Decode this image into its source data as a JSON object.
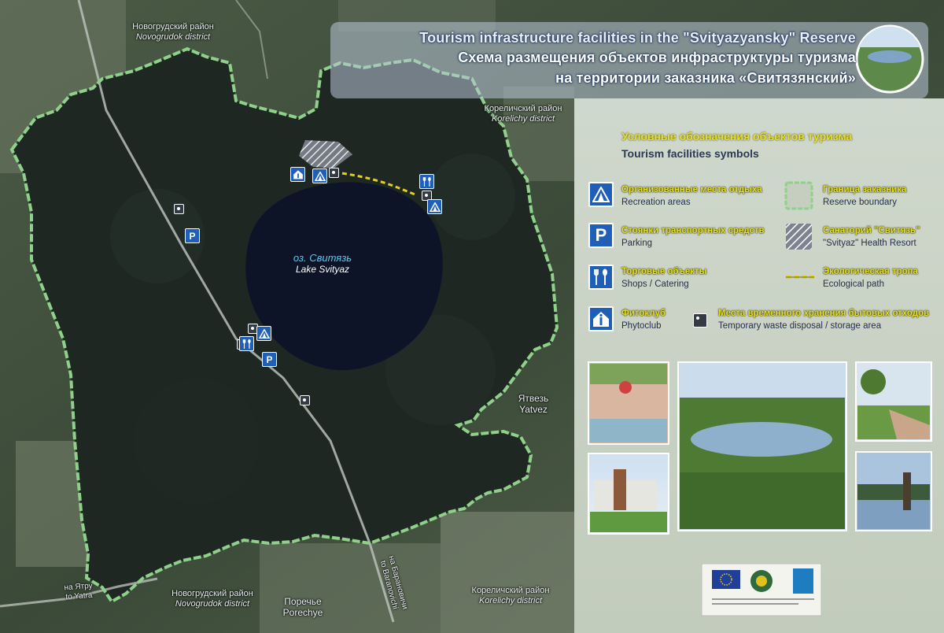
{
  "title": {
    "en": "Tourism infrastructure facilities in the \"Svityazyansky\" Reserve",
    "ru_line1": "Схема размещения объектов инфраструктуры туризма",
    "ru_line2": "на территории заказника «Свитязянский»"
  },
  "legend": {
    "title_ru": "Условные обозначения объектов туризма",
    "title_en": "Tourism facilities symbols",
    "items": [
      {
        "ru": "Организованные места отдыха",
        "en": "Recreation areas",
        "icon": "tent-icon"
      },
      {
        "ru": "Стоянки транспортных средств",
        "en": "Parking",
        "icon": "parking-icon"
      },
      {
        "ru": "Торговые объекты",
        "en": "Shops / Catering",
        "icon": "fork-spoon-icon"
      },
      {
        "ru": "Фитоклуб",
        "en": "Phytoclub",
        "icon": "info-house-icon"
      },
      {
        "ru": "Граница заказника",
        "en": "Reserve boundary",
        "icon": "boundary-icon"
      },
      {
        "ru": "Санаторий \"Свитязь\"",
        "en": "\"Svityaz\" Health Resort",
        "icon": "hatched-area-icon"
      },
      {
        "ru": "Экологическая тропа",
        "en": "Ecological path",
        "icon": "dashed-path-icon"
      },
      {
        "ru": "Места временного хранения бытовых отходов",
        "en": "Temporary waste disposal / storage area",
        "icon": "waste-bin-icon"
      }
    ]
  },
  "map": {
    "lake_ru": "оз. Свитязь",
    "lake_en": "Lake Svityaz",
    "districts": [
      {
        "ru": "Новогрудский район",
        "en": "Novogrudok district"
      },
      {
        "ru": "Кореличский район",
        "en": "Korelichy district"
      },
      {
        "ru": "Новогрудский район",
        "en": "Novogrudok district"
      },
      {
        "ru": "Кореличский район",
        "en": "Korelichy district"
      }
    ],
    "villages": [
      {
        "ru": "Ятвезь",
        "en": "Yatvez"
      },
      {
        "ru": "Поречье",
        "en": "Porechye"
      }
    ],
    "roads": [
      {
        "ru": "на Ятру",
        "en": "to Yatra"
      },
      {
        "ru": "на Барановичи",
        "en": "to Baranovichi"
      }
    ],
    "parking_glyph": "P"
  },
  "colors": {
    "boundary": "#8fd08a",
    "reserve_dark": "#1e2722",
    "lake": "#0d1428",
    "icon_blue": "#1f5fb8",
    "legend_bg": "#c9d3c4",
    "legend_yellow": "#e6e020"
  }
}
